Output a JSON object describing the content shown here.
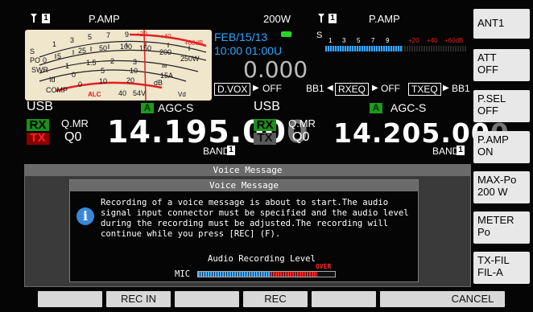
{
  "header": {
    "left_ant_badge": "1",
    "left_pamp": "P.AMP",
    "power": "200W",
    "right_ant_badge": "1",
    "right_pamp": "P.AMP"
  },
  "meter": {
    "s_label": "S",
    "po_label": "PO",
    "swr_label": "SWR",
    "id_label": "Id",
    "comp_label": "COMP",
    "alc_label": "ALC",
    "vd_label": "Vd",
    "s_ticks": [
      "1",
      "3",
      "5",
      "7",
      "9",
      "+20",
      "+40",
      "+60dB"
    ],
    "po_ticks": [
      "0",
      "5",
      "25",
      "50",
      "100",
      "150",
      "200",
      "250W"
    ],
    "swr_ticks": [
      "1",
      "1.5",
      "2",
      "3",
      "∞"
    ],
    "id_ticks": [
      "0",
      "5",
      "10",
      "15A"
    ],
    "comp_ticks": [
      "0",
      "10",
      "20",
      "dB"
    ],
    "vd_ticks": [
      "40",
      "54V"
    ]
  },
  "datetime": {
    "date": "FEB/15/13",
    "time": "10:00 01:00U"
  },
  "sub_display_value": "0.000",
  "right_sbar_scale": {
    "s_label": "S",
    "ticks": [
      "1",
      "3",
      "5",
      "7",
      "9",
      "+20",
      "+40",
      "+60dB"
    ]
  },
  "controls": {
    "dvox_label": "D.VOX",
    "dvox_state": "OFF",
    "bb1_label": "BB1",
    "rxeq_label": "RXEQ",
    "rxeq_state": "OFF",
    "txeq_label": "TXEQ",
    "txeq_target": "BB1"
  },
  "vfo_main": {
    "mode": "USB",
    "agc_badge": "A",
    "agc": "AGC-S",
    "rx": "RX",
    "tx": "TX",
    "qmr": "Q.MR",
    "q0": "Q0",
    "freq_main": "14.195.00",
    "freq_dim": "0",
    "band_label": "BAND",
    "band_num": "1"
  },
  "vfo_sub": {
    "mode": "USB",
    "agc_badge": "A",
    "agc": "AGC-S",
    "rx": "RX",
    "tx": "TX",
    "qmr": "Q.MR",
    "q0": "Q0",
    "freq_main": "14.205.00",
    "freq_dim": "0",
    "band_label": "BAND",
    "band_num": "1"
  },
  "side_buttons": [
    {
      "l1": "ANT1",
      "l2": ""
    },
    {
      "l1": "ATT",
      "l2": "OFF"
    },
    {
      "l1": "P.SEL",
      "l2": "OFF"
    },
    {
      "l1": "P.AMP",
      "l2": "ON"
    },
    {
      "l1": "MAX-Po",
      "l2": "200 W"
    },
    {
      "l1": "METER",
      "l2": "Po"
    },
    {
      "l1": "TX-FIL",
      "l2": "FIL-A"
    }
  ],
  "dialog": {
    "outer_title": "Voice Message",
    "inner_title": "Voice Message",
    "message": "Recording of a voice message is about to start.The audio signal input connector must be specified and the audio level during the recording must be adjusted.The recording will continue while you press [REC] (F).",
    "level_label": "Audio Recording Level",
    "mic_label": "MIC",
    "over_label": "OVER",
    "level_fraction": 0.87,
    "over_start_fraction": 0.53
  },
  "bottom_buttons": [
    "",
    "REC IN",
    "",
    "REC",
    "",
    "",
    "CANCEL"
  ],
  "colors": {
    "accent_blue": "#2aa6ff",
    "rx_green": "#1a8f1a",
    "tx_red": "#8a0000",
    "alc_red": "#e02020",
    "button_gray": "#d8d8d8"
  }
}
